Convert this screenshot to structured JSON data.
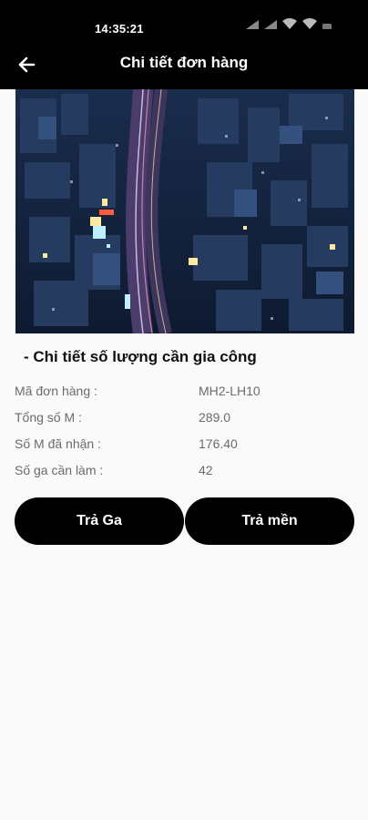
{
  "status_bar": {
    "time": "14:35:21"
  },
  "app_bar": {
    "title": "Chi tiết đơn hàng",
    "back_icon": "arrow-left-icon"
  },
  "hero": {
    "image": "night-city-aerial-photo"
  },
  "section": {
    "title": "- Chi tiết số lượng cần gia công"
  },
  "details": [
    {
      "label": "Mã đơn hàng :",
      "value": "MH2-LH10"
    },
    {
      "label": "Tổng số M :",
      "value": "289.0"
    },
    {
      "label": "Số M đã nhận :",
      "value": "176.40"
    },
    {
      "label": "Số ga cần làm :",
      "value": "42"
    }
  ],
  "actions": {
    "return_ga": "Trả Ga",
    "return_blanket": "Trả mền"
  },
  "colors": {
    "bar_background": "#000000",
    "page_background": "#fafafa",
    "button_background": "#000000",
    "label_text": "#6b6b6b"
  }
}
